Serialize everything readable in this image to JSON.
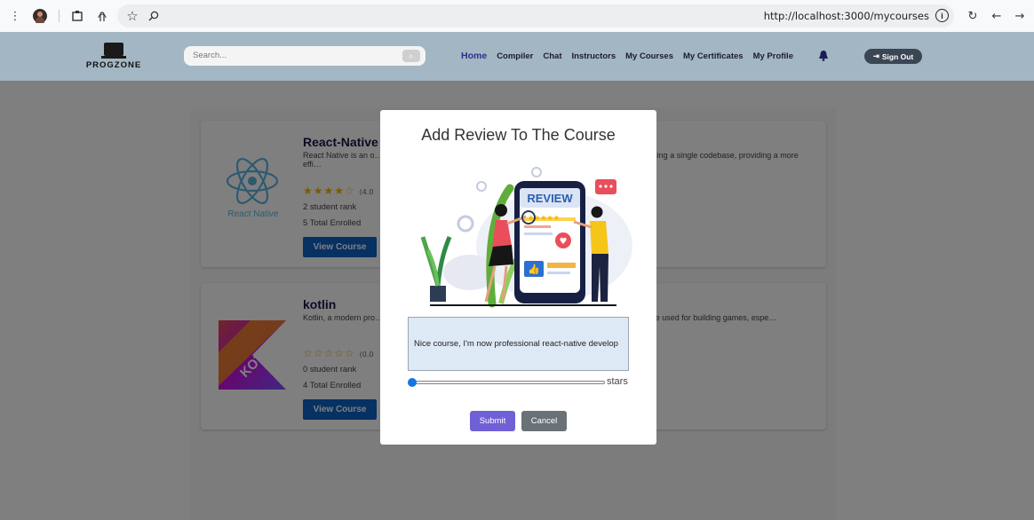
{
  "browser": {
    "url": "http://localhost:3000/mycourses",
    "icons": [
      "menu-dots-icon",
      "profile-icon",
      "extension-icon",
      "touch-icon",
      "bookmark-star-icon",
      "zoom-icon",
      "info-icon",
      "reload-icon",
      "back-icon",
      "forward-icon"
    ]
  },
  "navbar": {
    "brand": "PROGZONE",
    "search_placeholder": "Search...",
    "menu": [
      "Home",
      "Compiler",
      "Chat",
      "Instructors",
      "My Courses",
      "My Certificates",
      "My Profile"
    ],
    "active_menu": "Home",
    "signout_label": "Sign Out",
    "colors": {
      "bar": "#a3b6c3",
      "active": "#2e2e8f"
    }
  },
  "courses": [
    {
      "title": "React-Native",
      "description": "React Native is an o… mobile applications using JavaScript and React. It allows … roid platforms using a single codebase, providing a more effi…",
      "rating_stars": "★★★★☆",
      "rating_value": "(4.0",
      "rank": "2 student rank",
      "enrolled": "5 Total Enrolled",
      "button": "View Course",
      "thumb_label": "React Native"
    },
    {
      "title": "kotlin",
      "description": "Kotlin, a modern pro… ous domains, including game development. While … or C#, it can certainly be used for building games, espe…",
      "rating_stars": "☆☆☆☆☆",
      "rating_value": "(0.0",
      "rank": "0 student rank",
      "enrolled": "4 Total Enrolled",
      "button": "View Course",
      "thumb_label": "KOTLIN"
    }
  ],
  "modal": {
    "title": "Add Review To The Course",
    "review_text": "Nice course, I'm now professional react-native develop",
    "slider_label": "stars",
    "slider_value": 0,
    "submit_label": "Submit",
    "cancel_label": "Cancel",
    "illustration_word": "REVIEW",
    "colors": {
      "submit": "#7060d6",
      "cancel": "#6a7278",
      "view_course": "#0d63c4"
    }
  }
}
